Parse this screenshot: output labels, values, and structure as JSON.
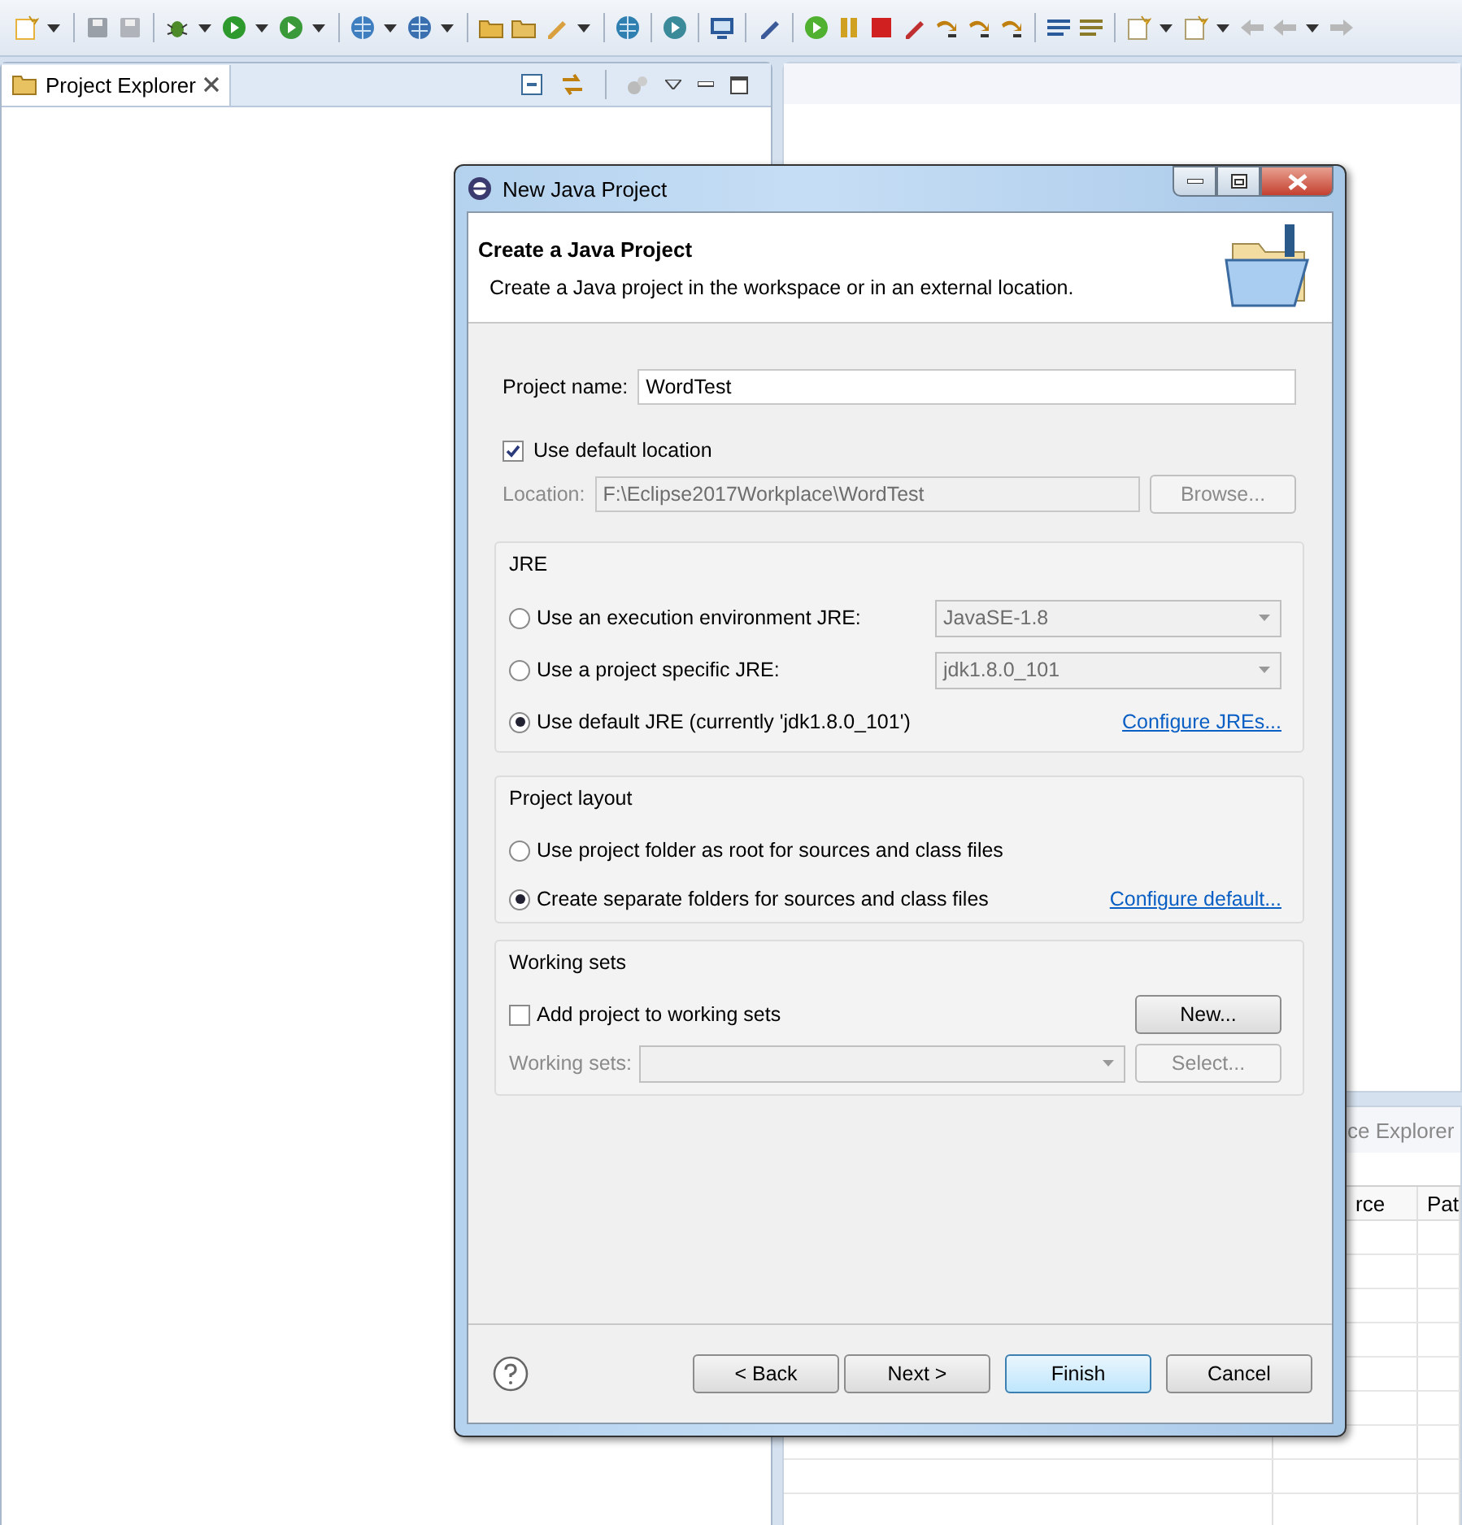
{
  "project_explorer": {
    "tab": {
      "label": "Project Explorer",
      "selected": true
    }
  },
  "bottom_panel": {
    "tab": {
      "label": "ce Explorer"
    },
    "columns": [
      "rce",
      "Pat"
    ]
  },
  "dialog": {
    "title": "New Java Project",
    "header": {
      "title": "Create a Java Project",
      "description": "Create a Java project in the workspace or in an external location."
    },
    "project_name": {
      "label": "Project name:",
      "value": "WordTest"
    },
    "use_default_location": {
      "label": "Use default location",
      "checked": true
    },
    "location": {
      "label": "Location:",
      "value": "F:\\Eclipse2017Workplace\\WordTest",
      "disabled": true
    },
    "browse_button": {
      "label": "Browse...",
      "disabled": true
    },
    "jre": {
      "title": "JRE",
      "options": [
        {
          "label": "Use an execution environment JRE:",
          "selected": false,
          "combo": {
            "value": "JavaSE-1.8",
            "disabled": true
          }
        },
        {
          "label": "Use a project specific JRE:",
          "selected": false,
          "combo": {
            "value": "jdk1.8.0_101",
            "disabled": true
          }
        },
        {
          "label": "Use default JRE (currently 'jdk1.8.0_101')",
          "selected": true,
          "link": "Configure JREs..."
        }
      ]
    },
    "project_layout": {
      "title": "Project layout",
      "options": [
        {
          "label": "Use project folder as root for sources and class files",
          "selected": false
        },
        {
          "label": "Create separate folders for sources and class files",
          "selected": true,
          "link": "Configure default..."
        }
      ]
    },
    "working_sets": {
      "title": "Working sets",
      "add": {
        "label": "Add project to working sets",
        "checked": false
      },
      "new_button": {
        "label": "New...",
        "disabled": false
      },
      "combo": {
        "label": "Working sets:",
        "disabled": true
      },
      "select_button": {
        "label": "Select...",
        "disabled": true
      }
    },
    "buttons": [
      {
        "label": "< Back",
        "kind": "normal"
      },
      {
        "label": "Next >",
        "kind": "normal"
      },
      {
        "label": "Finish",
        "kind": "default"
      },
      {
        "label": "Cancel",
        "kind": "normal"
      }
    ]
  }
}
